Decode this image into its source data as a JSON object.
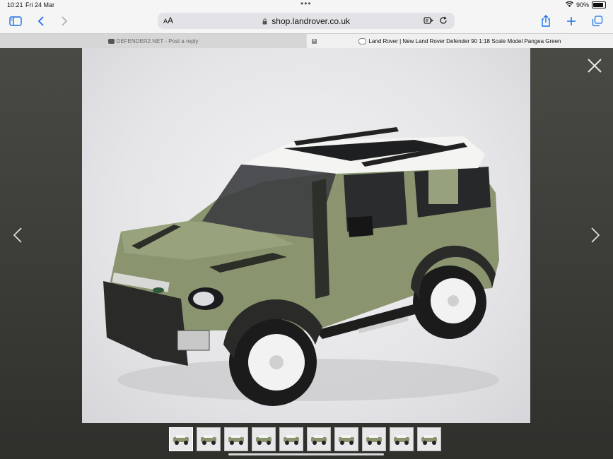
{
  "status_bar": {
    "time": "10:21",
    "date": "Fri 24 Mar",
    "battery_percent": "90%",
    "battery_level": 0.9,
    "wifi_icon": "wifi-icon",
    "battery_icon": "battery-icon"
  },
  "toolbar": {
    "sidebar_icon": "sidebar-icon",
    "back_icon": "chevron-left-icon",
    "forward_icon": "chevron-right-icon",
    "text_size_label": "AA",
    "url": "shop.landrover.co.uk",
    "lock_icon": "lock-icon",
    "reader_icon": "translate-icon",
    "reload_icon": "reload-icon",
    "share_icon": "share-icon",
    "new_tab_icon": "plus-icon",
    "tabs_icon": "tabs-icon",
    "accent_color": "#1a73e8"
  },
  "tabs": [
    {
      "label": "DEFENDER2.NET - Post a reply",
      "active": false
    },
    {
      "label": "Land Rover | New Land Rover Defender 90 1:18 Scale Model Pangea Green",
      "active": true
    }
  ],
  "viewer": {
    "close_icon": "close-icon",
    "prev_icon": "chevron-left-icon",
    "next_icon": "chevron-right-icon",
    "thumbnail_count": 10,
    "selected_thumbnail": 1,
    "car_color": "#8a9570"
  }
}
